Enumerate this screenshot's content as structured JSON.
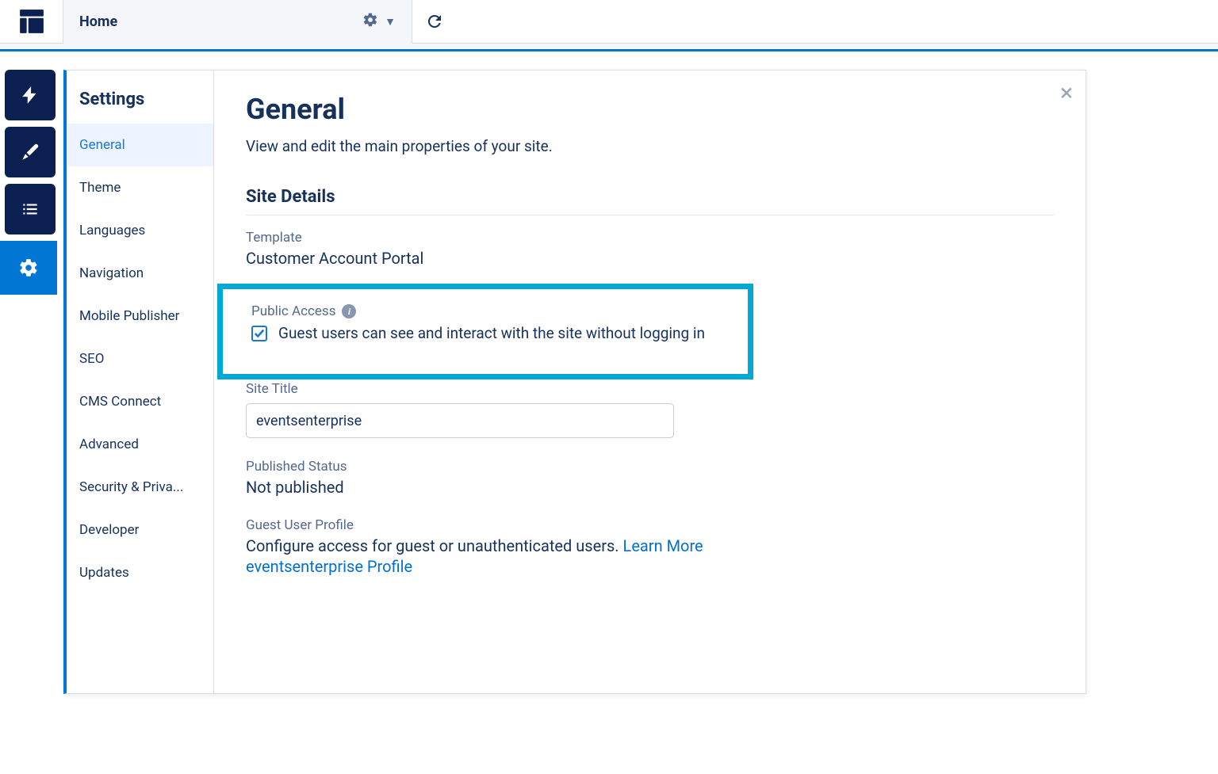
{
  "header": {
    "tab_title": "Home"
  },
  "sidebar": {
    "title": "Settings",
    "items": [
      {
        "label": "General",
        "active": true
      },
      {
        "label": "Theme"
      },
      {
        "label": "Languages"
      },
      {
        "label": "Navigation"
      },
      {
        "label": "Mobile Publisher"
      },
      {
        "label": "SEO"
      },
      {
        "label": "CMS Connect"
      },
      {
        "label": "Advanced"
      },
      {
        "label": "Security & Priva..."
      },
      {
        "label": "Developer"
      },
      {
        "label": "Updates"
      }
    ]
  },
  "content": {
    "title": "General",
    "description": "View and edit the main properties of your site.",
    "section_title": "Site Details",
    "template_label": "Template",
    "template_value": "Customer Account Portal",
    "public_access_label": "Public Access",
    "public_access_checkbox_label": "Guest users can see and interact with the site without logging in",
    "public_access_checked": true,
    "site_title_label": "Site Title",
    "site_title_value": "eventsenterprise",
    "published_status_label": "Published Status",
    "published_status_value": "Not published",
    "guest_profile_label": "Guest User Profile",
    "guest_profile_text": "Configure access for guest or unauthenticated users. ",
    "guest_profile_learn_more": "Learn More",
    "guest_profile_link": "eventsenterprise Profile"
  }
}
